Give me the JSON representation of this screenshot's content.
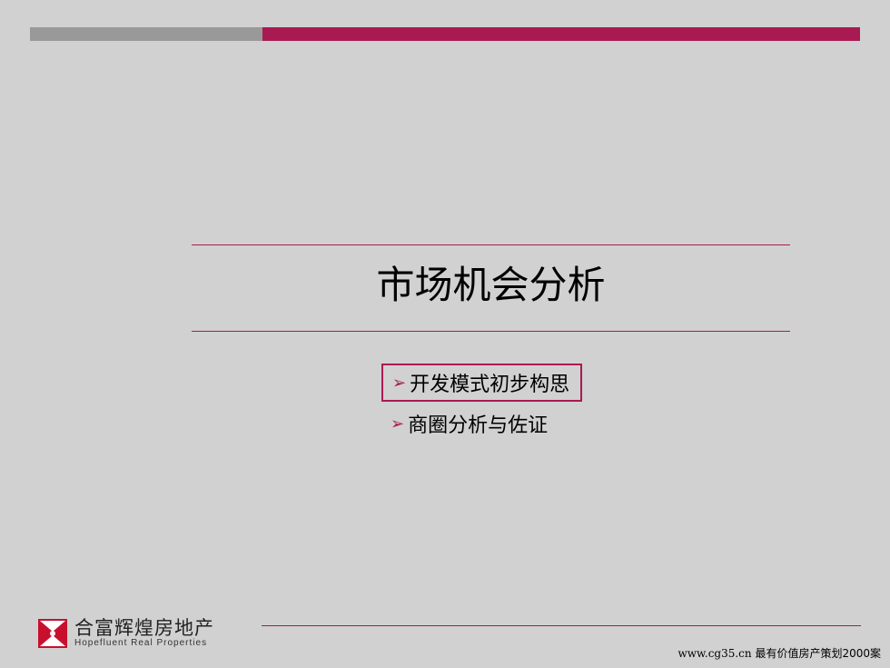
{
  "colors": {
    "accent": "#a91a52",
    "gray_bar": "#999999",
    "background": "#d1d1d1"
  },
  "slide": {
    "title": "市场机会分析",
    "bullets": [
      {
        "marker": "➢",
        "label": "开发模式初步构思",
        "selected": true
      },
      {
        "marker": "➢",
        "label": "商圈分析与佐证",
        "selected": false
      }
    ]
  },
  "logo": {
    "icon": "company-logo-icon",
    "name_cn": "合富辉煌房地产",
    "name_en": "Hopefluent Real Properties"
  },
  "footer": {
    "url": "www.cg35.cn",
    "tagline": "最有价值房产策划2000案"
  }
}
